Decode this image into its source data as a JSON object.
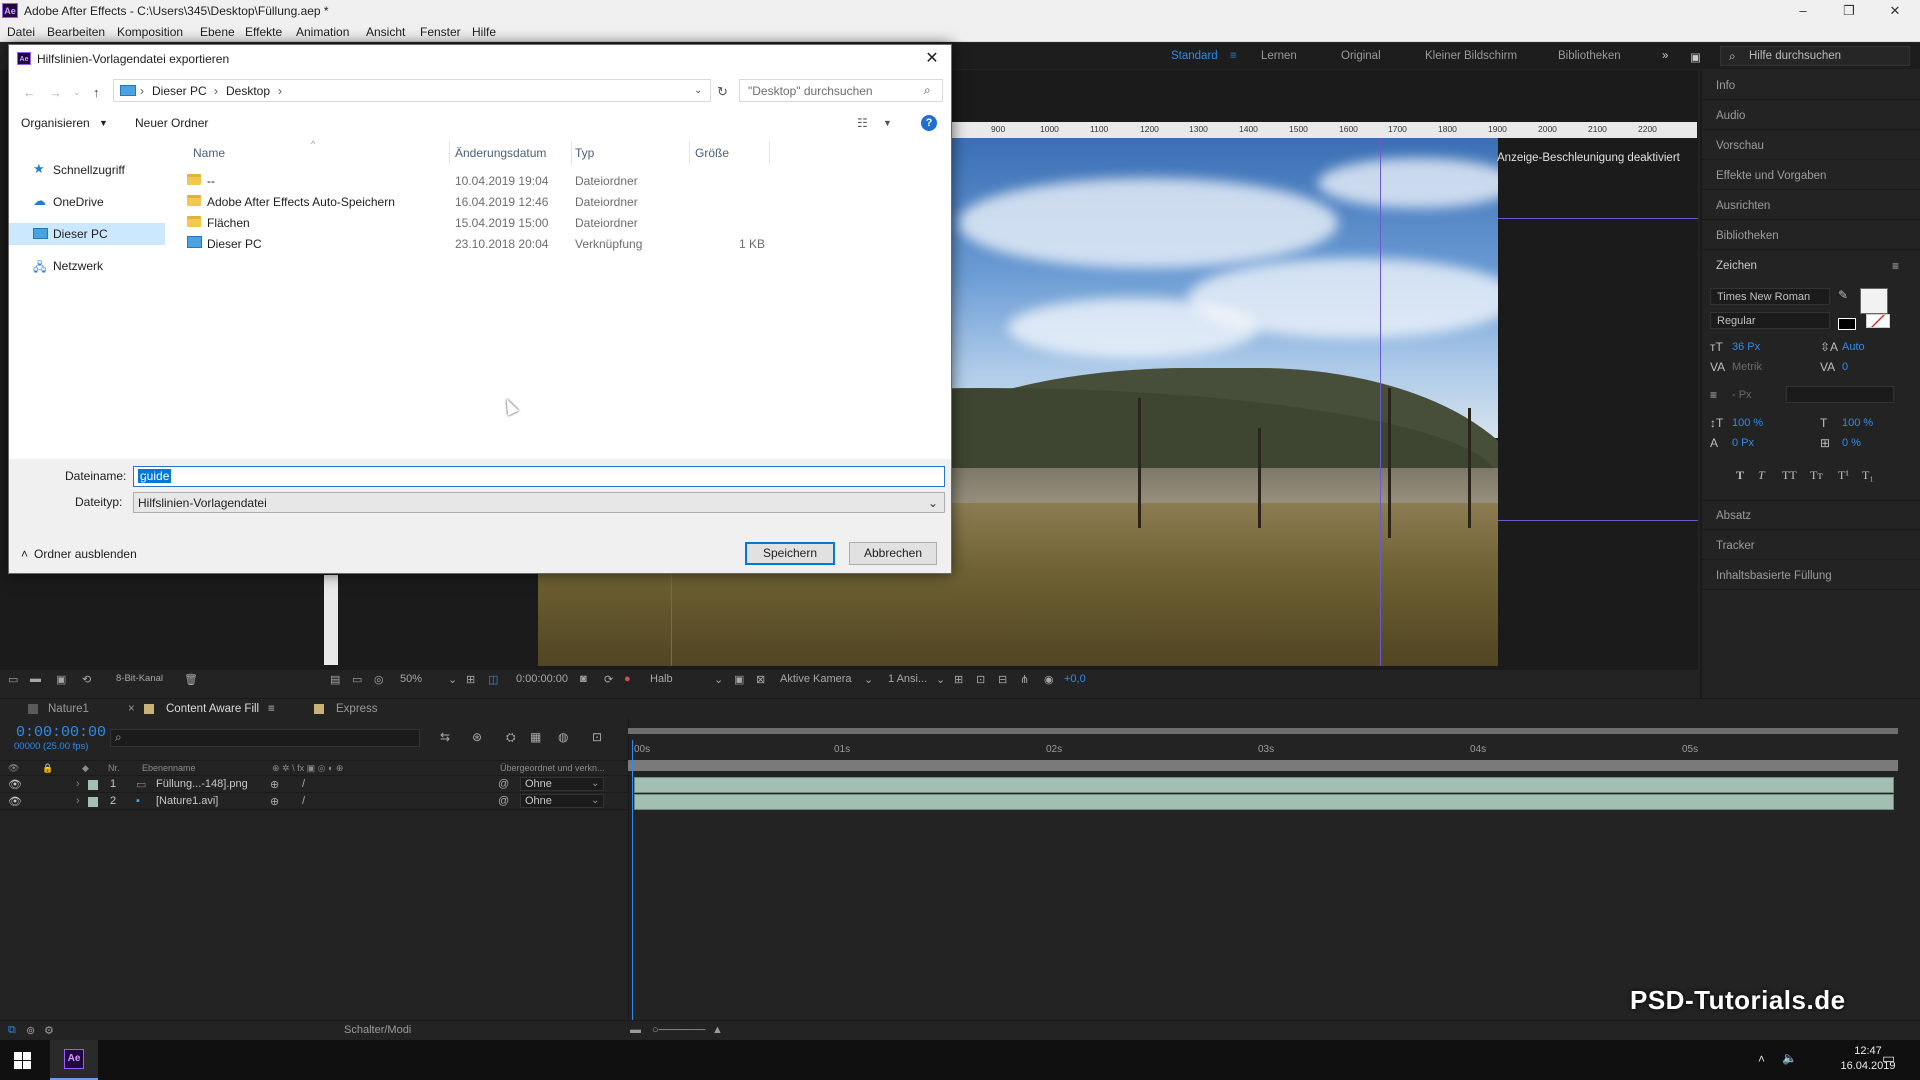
{
  "app": {
    "title": "Adobe After Effects - C:\\Users\\345\\Desktop\\Füllung.aep *",
    "logo": "Ae",
    "window_controls": [
      "–",
      "❐",
      "✕"
    ]
  },
  "menu": [
    "Datei",
    "Bearbeiten",
    "Komposition",
    "Ebene",
    "Effekte",
    "Animation",
    "Ansicht",
    "Fenster",
    "Hilfe"
  ],
  "workspace": {
    "items": [
      "Standard",
      "Lernen",
      "Original",
      "Kleiner Bildschirm",
      "Bibliotheken"
    ],
    "active": "Standard",
    "more": "»",
    "help_search": "Hilfe durchsuchen"
  },
  "right_panel": {
    "items": [
      "Info",
      "Audio",
      "Vorschau",
      "Effekte und Vorgaben",
      "Ausrichten",
      "Bibliotheken",
      "Zeichen"
    ],
    "character": {
      "font": "Times New Roman",
      "style": "Regular",
      "size": "36 Px",
      "leading": "Auto",
      "kerning": "Metrik",
      "tracking": "0",
      "stroke": "- Px",
      "vscale": "100 %",
      "hscale": "100 %",
      "baseline": "0 Px",
      "tsume": "0 %",
      "styles": [
        "T",
        "T",
        "TT",
        "Tт",
        "T¹",
        "T₁"
      ]
    },
    "bottom_items": [
      "Absatz",
      "Tracker",
      "Inhaltsbasierte Füllung"
    ]
  },
  "viewer": {
    "ruler_ticks": [
      "900",
      "1000",
      "1100",
      "1200",
      "1300",
      "1400",
      "1500",
      "1600",
      "1700",
      "1800",
      "1900",
      "2000",
      "2100",
      "2200"
    ],
    "accel_message": "Anzeige-Beschleunigung deaktiviert",
    "toolbar": {
      "bit_depth": "8-Bit-Kanal",
      "zoom": "50%",
      "time": "0:00:00:00",
      "resolution": "Halb",
      "camera": "Aktive Kamera",
      "views": "1 Ansi...",
      "exposure": "+0,0"
    }
  },
  "timeline": {
    "tabs": [
      {
        "label": "Nature1",
        "color": "#5a5a5a"
      },
      {
        "label": "Content Aware Fill",
        "color": "#c9b27a"
      },
      {
        "label": "Express",
        "color": "#c9b27a"
      }
    ],
    "timecode": "0:00:00:00",
    "fps": "00000 (25.00 fps)",
    "headers": {
      "nr": "Nr.",
      "name": "Ebenenname",
      "parent": "Übergeordnet und verkn..."
    },
    "layers": [
      {
        "nr": "1",
        "name": "Füllung...-148].png",
        "parent": "Ohne"
      },
      {
        "nr": "2",
        "name": "[Nature1.avi]",
        "parent": "Ohne"
      }
    ],
    "time_marks": [
      "00s",
      "01s",
      "02s",
      "03s",
      "04s",
      "05s"
    ],
    "mode_toggle": "Schalter/Modi"
  },
  "taskbar": {
    "time": "12:47",
    "date": "16.04.2019"
  },
  "watermark": "PSD-Tutorials.de",
  "dialog": {
    "title": "Hilfslinien-Vorlagendatei exportieren",
    "close": "✕",
    "breadcrumb": [
      "Dieser PC",
      "Desktop"
    ],
    "search_placeholder": "\"Desktop\" durchsuchen",
    "organize": "Organisieren",
    "new_folder": "Neuer Ordner",
    "help": "?",
    "nav": [
      {
        "label": "Schnellzugriff",
        "icon": "star-icon"
      },
      {
        "label": "OneDrive",
        "icon": "cloud-icon"
      },
      {
        "label": "Dieser PC",
        "icon": "computer-icon"
      },
      {
        "label": "Netzwerk",
        "icon": "network-icon"
      }
    ],
    "columns": [
      "Name",
      "Änderungsdatum",
      "Typ",
      "Größe"
    ],
    "files": [
      {
        "name": "--",
        "date": "10.04.2019 19:04",
        "type": "Dateiordner",
        "size": "",
        "icon": "folder-icon"
      },
      {
        "name": "Adobe After Effects Auto-Speichern",
        "date": "16.04.2019 12:46",
        "type": "Dateiordner",
        "size": "",
        "icon": "folder-icon"
      },
      {
        "name": "Flächen",
        "date": "15.04.2019 15:00",
        "type": "Dateiordner",
        "size": "",
        "icon": "folder-icon"
      },
      {
        "name": "Dieser PC",
        "date": "23.10.2018 20:04",
        "type": "Verknüpfung",
        "size": "1 KB",
        "icon": "computer-icon"
      }
    ],
    "filename_label": "Dateiname:",
    "filename_value": "guide",
    "filetype_label": "Dateityp:",
    "filetype_value": "Hilfslinien-Vorlagendatei",
    "hide_folders": "Ordner ausblenden",
    "save": "Speichern",
    "cancel": "Abbrechen"
  }
}
